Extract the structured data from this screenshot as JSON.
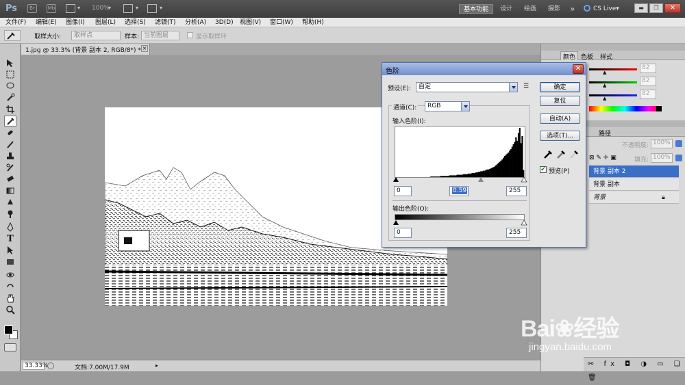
{
  "app": {
    "logo": "Ps",
    "zoom": "100%",
    "workspaces": [
      "基本功能",
      "设计",
      "绘画",
      "摄影"
    ],
    "more": "»",
    "cslive": "CS Live▾"
  },
  "menu": [
    "文件(F)",
    "编辑(E)",
    "图像(I)",
    "图层(L)",
    "选择(S)",
    "滤镜(T)",
    "分析(A)",
    "3D(D)",
    "视图(V)",
    "窗口(W)",
    "帮助(H)"
  ],
  "options": {
    "sample_size_label": "取样大小:",
    "sample_size_value": "取样点",
    "sample_label": "样本:",
    "sample_value": "当前图层",
    "show_ring": "显示取样环"
  },
  "document": {
    "tab_title": "1.jpg @ 33.3% (背景 副本 2, RGB/8*) *",
    "close": "×",
    "zoom": "33.33%",
    "doc_info": "文档:7.00M/17.9M"
  },
  "dialog": {
    "title": "色阶",
    "preset_label": "预设(E):",
    "preset_value": "自定",
    "channel_label": "通道(C):",
    "channel_value": "RGB",
    "input_label": "输入色阶(I):",
    "input_values": [
      "0",
      "0.59",
      "255"
    ],
    "output_label": "输出色阶(O):",
    "output_values": [
      "0",
      "255"
    ],
    "buttons": {
      "ok": "确定",
      "reset": "复位",
      "auto": "自动(A)",
      "options": "选项(T)..."
    },
    "preview_label": "预览(P)",
    "histogram": [
      0,
      0,
      0,
      0,
      0,
      0,
      0,
      0,
      0,
      0,
      0,
      0,
      0,
      0,
      0,
      0,
      0,
      0,
      0,
      0,
      0,
      0,
      0,
      0,
      0,
      0,
      0,
      0,
      1,
      1,
      1,
      1,
      1,
      1,
      1,
      1,
      2,
      2,
      2,
      2,
      2,
      2,
      2,
      3,
      3,
      3,
      3,
      3,
      3,
      4,
      4,
      4,
      4,
      4,
      5,
      5,
      5,
      5,
      6,
      6,
      6,
      7,
      7,
      7,
      8,
      8,
      9,
      9,
      10,
      10,
      11,
      11,
      12,
      13,
      13,
      14,
      15,
      16,
      17,
      18,
      20,
      22,
      24,
      26,
      28,
      30,
      33,
      36,
      38,
      40,
      42,
      45,
      48,
      52,
      56,
      60,
      68,
      62,
      75,
      84,
      58,
      70,
      12
    ]
  },
  "panels": {
    "color_tabs": [
      "颜色",
      "色板",
      "样式"
    ],
    "color_values": [
      "82",
      "82",
      "82"
    ],
    "layers_tabs": [
      "路径"
    ],
    "opacity_label": "不透明度:",
    "opacity_value": "100%",
    "fill_label": "填充:",
    "fill_value": "100%",
    "layers": [
      {
        "name": "背景 副本 2",
        "selected": true
      },
      {
        "name": "背景 副本",
        "selected": false
      },
      {
        "name": "背景",
        "selected": false,
        "locked": true
      }
    ]
  },
  "watermark": {
    "brand": "Bai",
    "brand2": "经验",
    "url": "jingyan.baidu.com"
  },
  "colors": {
    "selection": "#3a6fc7",
    "dialog_title": "#4f6fb0",
    "ws_active": "#6b6b6b"
  }
}
